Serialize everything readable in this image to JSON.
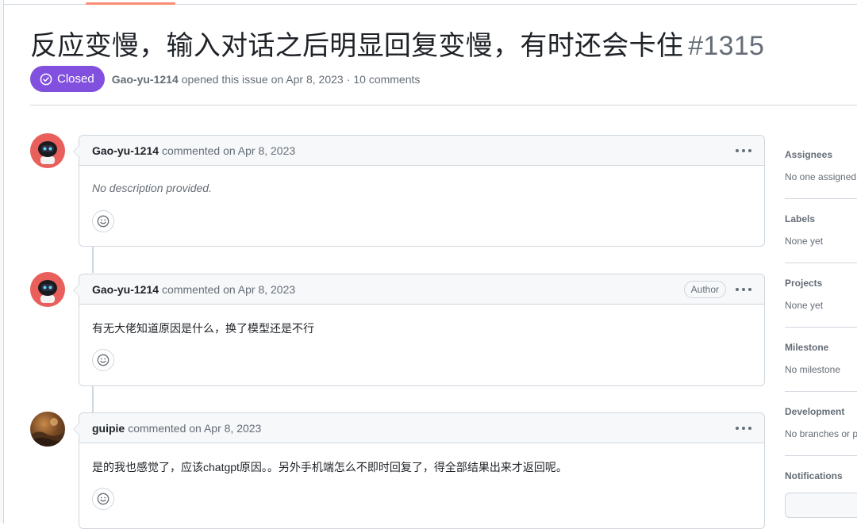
{
  "issue": {
    "title": "反应变慢，输入对话之后明显回复变慢，有时还会卡住",
    "number": "#1315",
    "state": "Closed",
    "author": "Gao-yu-1214",
    "opened_text": "opened this issue on Apr 8, 2023",
    "separator": "·",
    "comments_count": "10 comments"
  },
  "comments": [
    {
      "author": "Gao-yu-1214",
      "action": "commented on Apr 8, 2023",
      "badge": "",
      "body": "No description provided.",
      "avatar": "robot-avatar"
    },
    {
      "author": "Gao-yu-1214",
      "action": "commented on Apr 8, 2023",
      "badge": "Author",
      "body": "有无大佬知道原因是什么，换了模型还是不行",
      "avatar": "robot-avatar"
    },
    {
      "author": "guipie",
      "action": "commented on Apr 8, 2023",
      "badge": "",
      "body": "是的我也感觉了，应该chatgpt原因。。另外手机端怎么不即时回复了，得全部结果出来才返回呢。",
      "avatar": "photo-avatar"
    }
  ],
  "sidebar": {
    "assignees": {
      "title": "Assignees",
      "value": "No one assigned"
    },
    "labels": {
      "title": "Labels",
      "value": "None yet"
    },
    "projects": {
      "title": "Projects",
      "value": "None yet"
    },
    "milestone": {
      "title": "Milestone",
      "value": "No milestone"
    },
    "development": {
      "title": "Development",
      "value": "No branches or pull requests"
    },
    "notifications": {
      "title": "Notifications"
    }
  },
  "colors": {
    "closed_badge": "#8250df",
    "tab_accent": "#fd8c73",
    "robot_avatar_bg": "#e85f5c",
    "muted_text": "#656d76",
    "border": "#d0d7de",
    "header_bg": "#f6f8fa"
  },
  "icons": {
    "state": "check-circle-icon",
    "comment_menu": "kebab-horizontal-icon",
    "reaction": "smiley-icon"
  }
}
